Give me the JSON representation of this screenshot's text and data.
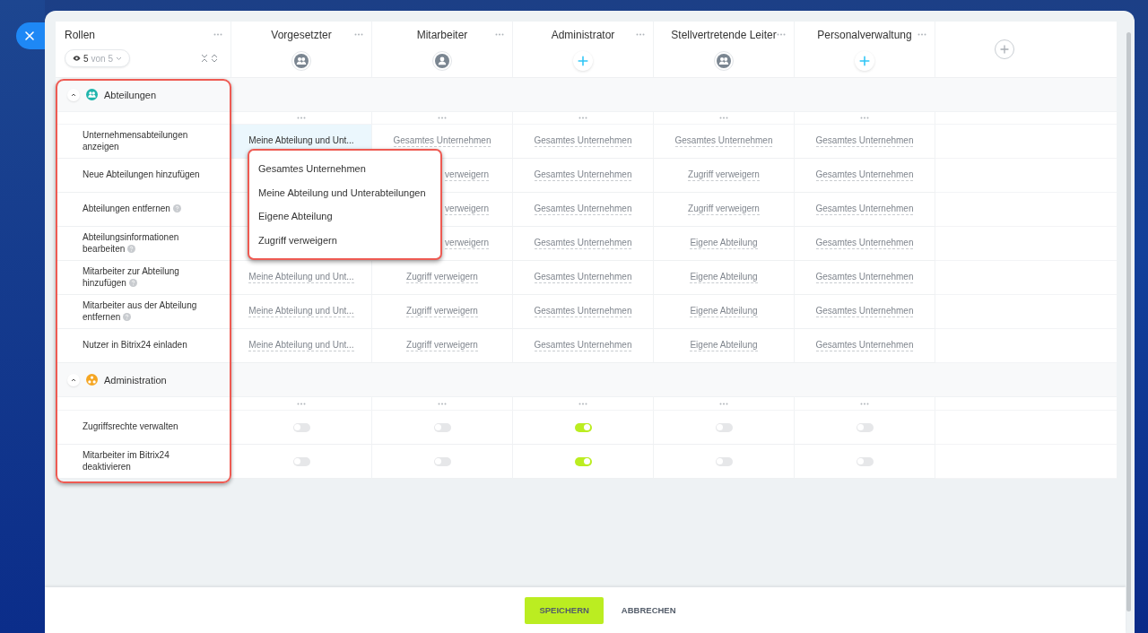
{
  "roles_column": {
    "title": "Rollen",
    "filter": {
      "count": "5",
      "total": "von 5"
    }
  },
  "roles": [
    {
      "name": "Vorgesetzter",
      "kind": "group"
    },
    {
      "name": "Mitarbeiter",
      "kind": "person"
    },
    {
      "name": "Administrator",
      "kind": "add"
    },
    {
      "name": "Stellvertretende Leiter",
      "kind": "group"
    },
    {
      "name": "Personalverwaltung",
      "kind": "add"
    }
  ],
  "sections": [
    {
      "title": "Abteilungen",
      "color": "#1fb5ad",
      "expanded": true,
      "rows": [
        {
          "label": "Unternehmensabteilungen anzeigen",
          "help": false,
          "kind": "select",
          "cells": [
            {
              "value": "Meine Abteilung und Unt...",
              "selected": true
            },
            {
              "value": "Gesamtes Unternehmen",
              "selected": false
            },
            {
              "value": "Gesamtes Unternehmen",
              "selected": false
            },
            {
              "value": "Gesamtes Unternehmen",
              "selected": false
            },
            {
              "value": "Gesamtes Unternehmen",
              "selected": false
            }
          ]
        },
        {
          "label": "Neue Abteilungen hinzufügen",
          "help": false,
          "kind": "select",
          "cells": [
            {
              "selected": false
            },
            {
              "value": "verweigern",
              "selected": false,
              "covered": true
            },
            {
              "value": "Gesamtes Unternehmen",
              "selected": false
            },
            {
              "value": "Zugriff verweigern",
              "selected": false
            },
            {
              "value": "Gesamtes Unternehmen",
              "selected": false
            }
          ]
        },
        {
          "label": "Abteilungen entfernen",
          "help": true,
          "kind": "select",
          "cells": [
            {
              "selected": false
            },
            {
              "value": "verweigern",
              "selected": false,
              "covered": true
            },
            {
              "value": "Gesamtes Unternehmen",
              "selected": false
            },
            {
              "value": "Zugriff verweigern",
              "selected": false
            },
            {
              "value": "Gesamtes Unternehmen",
              "selected": false
            }
          ]
        },
        {
          "label": "Abteilungsinformationen bearbeiten",
          "help": true,
          "kind": "select",
          "cells": [
            {
              "selected": false
            },
            {
              "value": "verweigern",
              "selected": false,
              "covered": true
            },
            {
              "value": "Gesamtes Unternehmen",
              "selected": false
            },
            {
              "value": "Eigene Abteilung",
              "selected": false
            },
            {
              "value": "Gesamtes Unternehmen",
              "selected": false
            }
          ]
        },
        {
          "label": "Mitarbeiter zur Abteilung hinzufügen",
          "help": true,
          "kind": "select",
          "cells": [
            {
              "value": "Meine Abteilung und Unt...",
              "selected": false
            },
            {
              "value": "Zugriff verweigern",
              "selected": false
            },
            {
              "value": "Gesamtes Unternehmen",
              "selected": false
            },
            {
              "value": "Eigene Abteilung",
              "selected": false
            },
            {
              "value": "Gesamtes Unternehmen",
              "selected": false
            }
          ]
        },
        {
          "label": "Mitarbeiter aus der Abteilung entfernen",
          "help": true,
          "kind": "select",
          "cells": [
            {
              "value": "Meine Abteilung und Unt...",
              "selected": false
            },
            {
              "value": "Zugriff verweigern",
              "selected": false
            },
            {
              "value": "Gesamtes Unternehmen",
              "selected": false
            },
            {
              "value": "Eigene Abteilung",
              "selected": false
            },
            {
              "value": "Gesamtes Unternehmen",
              "selected": false
            }
          ]
        },
        {
          "label": "Nutzer in Bitrix24 einladen",
          "help": false,
          "kind": "select",
          "cells": [
            {
              "value": "Meine Abteilung und Unt...",
              "selected": false
            },
            {
              "value": "Zugriff verweigern",
              "selected": false
            },
            {
              "value": "Gesamtes Unternehmen",
              "selected": false
            },
            {
              "value": "Eigene Abteilung",
              "selected": false
            },
            {
              "value": "Gesamtes Unternehmen",
              "selected": false
            }
          ]
        }
      ]
    },
    {
      "title": "Administration",
      "color": "#f5a623",
      "expanded": true,
      "rows": [
        {
          "label": "Zugriffsrechte verwalten",
          "help": false,
          "kind": "toggle",
          "cells": [
            {
              "on": false
            },
            {
              "on": false
            },
            {
              "on": true
            },
            {
              "on": false
            },
            {
              "on": false
            }
          ]
        },
        {
          "label": "Mitarbeiter im Bitrix24 deaktivieren",
          "help": false,
          "kind": "toggle",
          "cells": [
            {
              "on": false
            },
            {
              "on": false
            },
            {
              "on": true
            },
            {
              "on": false
            },
            {
              "on": false
            }
          ]
        }
      ]
    }
  ],
  "dropdown": {
    "options": [
      "Gesamtes Unternehmen",
      "Meine Abteilung und Unterabteilungen",
      "Eigene Abteilung",
      "Zugriff verweigern"
    ]
  },
  "footer": {
    "save": "SPEICHERN",
    "cancel": "ABBRECHEN"
  }
}
